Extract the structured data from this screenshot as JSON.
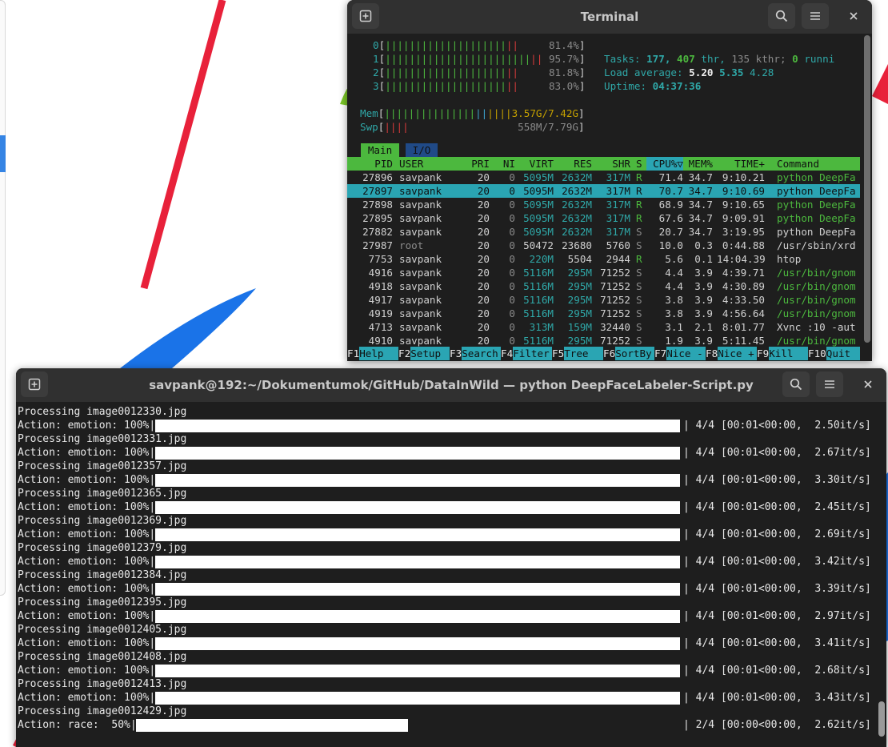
{
  "htop_window": {
    "title": "Terminal",
    "cpus": [
      {
        "id": "0",
        "percent": "81.4%",
        "value": 81.4
      },
      {
        "id": "1",
        "percent": "95.7%",
        "value": 95.7
      },
      {
        "id": "2",
        "percent": "81.8%",
        "value": 81.8
      },
      {
        "id": "3",
        "percent": "83.0%",
        "value": 83.0
      }
    ],
    "mem": {
      "label": "Mem",
      "value": "3.57G/7.42G"
    },
    "swp": {
      "label": "Swp",
      "value": "558M/7.79G"
    },
    "tasks": {
      "label": "Tasks:",
      "tasks": "177,",
      "thr": "407",
      "thr_label": "thr,",
      "kthr": "135 kthr;",
      "running": "0",
      "running_label": "runni"
    },
    "load": {
      "label": "Load average:",
      "l1": "5.20",
      "l5": "5.35",
      "l15": "4.28"
    },
    "uptime": {
      "label": "Uptime:",
      "value": "04:37:36"
    },
    "tabs": [
      "Main",
      "I/O"
    ],
    "columns": [
      "PID",
      "USER",
      "PRI",
      "NI",
      "VIRT",
      "RES",
      "SHR",
      "S",
      "CPU%▽",
      "MEM%",
      "TIME+",
      "Command"
    ],
    "processes": [
      {
        "pid": "27896",
        "user": "savpank",
        "pri": "20",
        "ni": "0",
        "virt": "5095M",
        "res": "2632M",
        "shr": "317M",
        "s": "R",
        "cpu": "71.4",
        "mem": "34.7",
        "time": "9:10.21",
        "cmd": "python DeepFa"
      },
      {
        "pid": "27897",
        "user": "savpank",
        "pri": "20",
        "ni": "0",
        "virt": "5095M",
        "res": "2632M",
        "shr": "317M",
        "s": "R",
        "cpu": "70.7",
        "mem": "34.7",
        "time": "9:10.69",
        "cmd": "python DeepFa"
      },
      {
        "pid": "27898",
        "user": "savpank",
        "pri": "20",
        "ni": "0",
        "virt": "5095M",
        "res": "2632M",
        "shr": "317M",
        "s": "R",
        "cpu": "68.9",
        "mem": "34.7",
        "time": "9:10.65",
        "cmd": "python DeepFa"
      },
      {
        "pid": "27895",
        "user": "savpank",
        "pri": "20",
        "ni": "0",
        "virt": "5095M",
        "res": "2632M",
        "shr": "317M",
        "s": "R",
        "cpu": "67.6",
        "mem": "34.7",
        "time": "9:09.91",
        "cmd": "python DeepFa"
      },
      {
        "pid": "27882",
        "user": "savpank",
        "pri": "20",
        "ni": "0",
        "virt": "5095M",
        "res": "2632M",
        "shr": "317M",
        "s": "S",
        "cpu": "20.7",
        "mem": "34.7",
        "time": "3:19.95",
        "cmd": "python DeepFa"
      },
      {
        "pid": "27987",
        "user": "root",
        "pri": "20",
        "ni": "0",
        "virt": "50472",
        "res": "23680",
        "shr": "5760",
        "s": "S",
        "cpu": "10.0",
        "mem": "0.3",
        "time": "0:44.88",
        "cmd": "/usr/sbin/xrd"
      },
      {
        "pid": "7753",
        "user": "savpank",
        "pri": "20",
        "ni": "0",
        "virt": "220M",
        "res": "5504",
        "shr": "2944",
        "s": "R",
        "cpu": "5.6",
        "mem": "0.1",
        "time": "14:04.39",
        "cmd": "htop"
      },
      {
        "pid": "4916",
        "user": "savpank",
        "pri": "20",
        "ni": "0",
        "virt": "5116M",
        "res": "295M",
        "shr": "71252",
        "s": "S",
        "cpu": "4.4",
        "mem": "3.9",
        "time": "4:39.71",
        "cmd": "/usr/bin/gnom"
      },
      {
        "pid": "4918",
        "user": "savpank",
        "pri": "20",
        "ni": "0",
        "virt": "5116M",
        "res": "295M",
        "shr": "71252",
        "s": "S",
        "cpu": "4.4",
        "mem": "3.9",
        "time": "4:30.89",
        "cmd": "/usr/bin/gnom"
      },
      {
        "pid": "4917",
        "user": "savpank",
        "pri": "20",
        "ni": "0",
        "virt": "5116M",
        "res": "295M",
        "shr": "71252",
        "s": "S",
        "cpu": "3.8",
        "mem": "3.9",
        "time": "4:33.50",
        "cmd": "/usr/bin/gnom"
      },
      {
        "pid": "4919",
        "user": "savpank",
        "pri": "20",
        "ni": "0",
        "virt": "5116M",
        "res": "295M",
        "shr": "71252",
        "s": "S",
        "cpu": "3.8",
        "mem": "3.9",
        "time": "4:56.64",
        "cmd": "/usr/bin/gnom"
      },
      {
        "pid": "4713",
        "user": "savpank",
        "pri": "20",
        "ni": "0",
        "virt": "313M",
        "res": "159M",
        "shr": "32440",
        "s": "S",
        "cpu": "3.1",
        "mem": "2.1",
        "time": "8:01.77",
        "cmd": "Xvnc :10 -aut"
      },
      {
        "pid": "4910",
        "user": "savpank",
        "pri": "20",
        "ni": "0",
        "virt": "5116M",
        "res": "295M",
        "shr": "71252",
        "s": "S",
        "cpu": "1.9",
        "mem": "3.9",
        "time": "5:11.45",
        "cmd": "/usr/bin/gnom"
      }
    ],
    "fkeys": [
      {
        "key": "F1",
        "label": "Help"
      },
      {
        "key": "F2",
        "label": "Setup"
      },
      {
        "key": "F3",
        "label": "Search"
      },
      {
        "key": "F4",
        "label": "Filter"
      },
      {
        "key": "F5",
        "label": "Tree"
      },
      {
        "key": "F6",
        "label": "SortBy"
      },
      {
        "key": "F7",
        "label": "Nice -"
      },
      {
        "key": "F8",
        "label": "Nice +"
      },
      {
        "key": "F9",
        "label": "Kill"
      },
      {
        "key": "F10",
        "label": "Quit"
      }
    ]
  },
  "script_window": {
    "title": "savpank@192:~/Dokumentumok/GitHub/DataInWild — python DeepFaceLabeler-Script.py",
    "lines": [
      {
        "kind": "proc",
        "text": "Processing image0012330.jpg"
      },
      {
        "kind": "bar",
        "prefix": "Action: emotion: 100%|",
        "fill": 1.0,
        "suffix": "| 4/4 [00:01<00:00,  2.50it/s]"
      },
      {
        "kind": "proc",
        "text": "Processing image0012331.jpg"
      },
      {
        "kind": "bar",
        "prefix": "Action: emotion: 100%|",
        "fill": 1.0,
        "suffix": "| 4/4 [00:01<00:00,  2.67it/s]"
      },
      {
        "kind": "proc",
        "text": "Processing image0012357.jpg"
      },
      {
        "kind": "bar",
        "prefix": "Action: emotion: 100%|",
        "fill": 1.0,
        "suffix": "| 4/4 [00:01<00:00,  3.30it/s]"
      },
      {
        "kind": "proc",
        "text": "Processing image0012365.jpg"
      },
      {
        "kind": "bar",
        "prefix": "Action: emotion: 100%|",
        "fill": 1.0,
        "suffix": "| 4/4 [00:01<00:00,  2.45it/s]"
      },
      {
        "kind": "proc",
        "text": "Processing image0012369.jpg"
      },
      {
        "kind": "bar",
        "prefix": "Action: emotion: 100%|",
        "fill": 1.0,
        "suffix": "| 4/4 [00:01<00:00,  2.69it/s]"
      },
      {
        "kind": "proc",
        "text": "Processing image0012379.jpg"
      },
      {
        "kind": "bar",
        "prefix": "Action: emotion: 100%|",
        "fill": 1.0,
        "suffix": "| 4/4 [00:01<00:00,  3.42it/s]"
      },
      {
        "kind": "proc",
        "text": "Processing image0012384.jpg"
      },
      {
        "kind": "bar",
        "prefix": "Action: emotion: 100%|",
        "fill": 1.0,
        "suffix": "| 4/4 [00:01<00:00,  3.39it/s]"
      },
      {
        "kind": "proc",
        "text": "Processing image0012395.jpg"
      },
      {
        "kind": "bar",
        "prefix": "Action: emotion: 100%|",
        "fill": 1.0,
        "suffix": "| 4/4 [00:01<00:00,  2.97it/s]"
      },
      {
        "kind": "proc",
        "text": "Processing image0012405.jpg"
      },
      {
        "kind": "bar",
        "prefix": "Action: emotion: 100%|",
        "fill": 1.0,
        "suffix": "| 4/4 [00:01<00:00,  3.41it/s]"
      },
      {
        "kind": "proc",
        "text": "Processing image0012408.jpg"
      },
      {
        "kind": "bar",
        "prefix": "Action: emotion: 100%|",
        "fill": 1.0,
        "suffix": "| 4/4 [00:01<00:00,  2.68it/s]"
      },
      {
        "kind": "proc",
        "text": "Processing image0012413.jpg"
      },
      {
        "kind": "bar",
        "prefix": "Action: emotion: 100%|",
        "fill": 1.0,
        "suffix": "| 4/4 [00:01<00:00,  3.43it/s]"
      },
      {
        "kind": "proc",
        "text": "Processing image0012429.jpg"
      },
      {
        "kind": "bar",
        "prefix": "Action: race:  50%|",
        "fill": 0.5,
        "suffix": "| 2/4 [00:00<00:00,  2.62it/s]"
      }
    ]
  },
  "icons": {
    "new_tab": "new-tab-icon",
    "search": "search-icon",
    "menu": "hamburger-menu-icon",
    "close": "close-icon"
  },
  "colors": {
    "green": "#4cb83e",
    "red": "#d33a3a",
    "cyan": "#2aa5b3",
    "selected_row": "#2aa5b3",
    "terminal_bg": "#1e1e1e"
  }
}
